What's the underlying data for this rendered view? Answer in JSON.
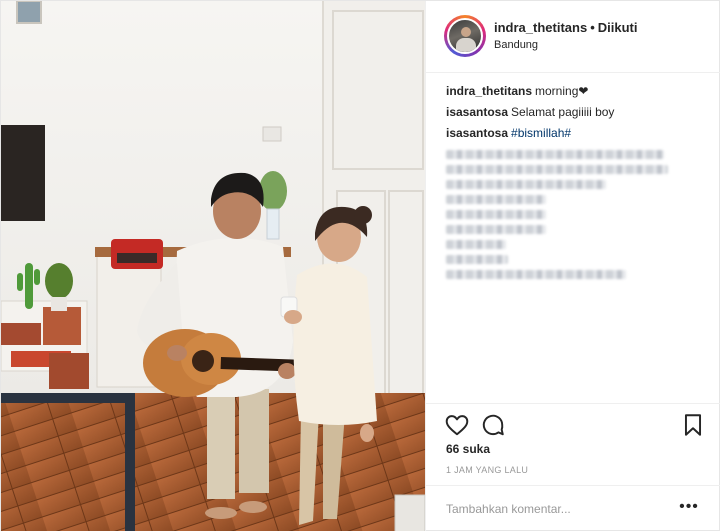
{
  "post": {
    "username": "indra_thetitans",
    "separator": "•",
    "follow_label": "Diikuti",
    "location": "Bandung"
  },
  "comments": [
    {
      "user": "indra_thetitans",
      "text": "morning❤"
    },
    {
      "user": "isasantosa",
      "text": "Selamat pagiiiii boy"
    },
    {
      "user": "isasantosa",
      "hashtag": "#bismillah#"
    }
  ],
  "actions": {
    "like_icon": "heart-outline-icon",
    "comment_icon": "speech-bubble-icon",
    "save_icon": "bookmark-icon"
  },
  "likes_text": "66 suka",
  "timestamp": "1 JAM YANG LALU",
  "comment_box": {
    "placeholder": "Tambahkan komentar...",
    "more_label": "•••"
  },
  "colors": {
    "text": "#262626",
    "hashtag": "#003569",
    "muted": "#999999",
    "divider": "#efefef"
  }
}
